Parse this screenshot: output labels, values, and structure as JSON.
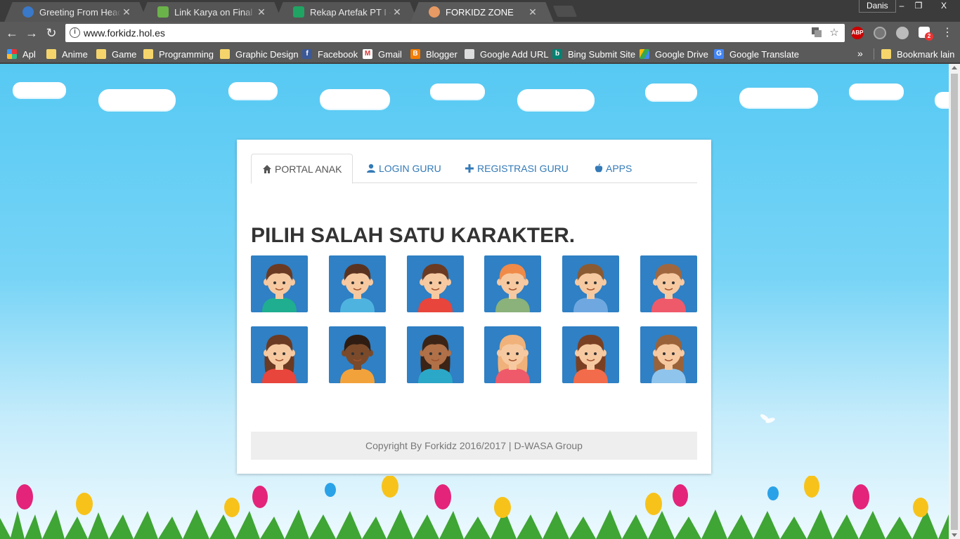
{
  "browser": {
    "tabs": [
      {
        "title": "Greeting From Head of P",
        "favicon": "globe-icon",
        "color": "#3a78c9"
      },
      {
        "title": "Link Karya on Final Yosh",
        "favicon": "trello-icon",
        "color": "#6bb24a"
      },
      {
        "title": "Rekap Artefak PT I - Goo",
        "favicon": "sheets-icon",
        "color": "#1fa463"
      },
      {
        "title": "FORKIDZ ZONE",
        "favicon": "kid-icon",
        "color": "#e79a63"
      }
    ],
    "profile_name": "Danis",
    "window_buttons": {
      "minimize": "–",
      "restore": "❐",
      "close": "X"
    },
    "url": "www.forkidz.hol.es",
    "extension_badge": "2",
    "abp_label": "ABP"
  },
  "bookmarks": {
    "items": [
      {
        "label": "Apl",
        "icon": "apps-grid-icon"
      },
      {
        "label": "Anime",
        "icon": "folder-icon"
      },
      {
        "label": "Game",
        "icon": "folder-icon"
      },
      {
        "label": "Programming",
        "icon": "folder-icon"
      },
      {
        "label": "Graphic Design",
        "icon": "folder-icon"
      },
      {
        "label": "Facebook",
        "icon": "facebook-icon"
      },
      {
        "label": "Gmail",
        "icon": "gmail-icon"
      },
      {
        "label": "Blogger",
        "icon": "blogger-icon"
      },
      {
        "label": "Google Add URL",
        "icon": "google-add-url-icon"
      },
      {
        "label": "Bing Submit Site",
        "icon": "bing-icon"
      },
      {
        "label": "Google Drive",
        "icon": "drive-icon"
      },
      {
        "label": "Google Translate",
        "icon": "translate-icon"
      }
    ],
    "more": "»",
    "other_bookmarks": "Bookmark lain"
  },
  "page": {
    "tabs": [
      {
        "label": "PORTAL ANAK",
        "icon": "home-icon",
        "active": true
      },
      {
        "label": "LOGIN GURU",
        "icon": "user-icon",
        "active": false
      },
      {
        "label": "REGISTRASI GURU",
        "icon": "plus-icon",
        "active": false
      },
      {
        "label": "APPS",
        "icon": "apple-icon",
        "active": false
      }
    ],
    "heading": "PILIH SALAH SATU KARAKTER.",
    "characters": [
      {
        "kind": "boy",
        "hair": "#6b3a22",
        "shirt": "#1fae8f"
      },
      {
        "kind": "boy",
        "hair": "#5a3320",
        "shirt": "#4fb3e0"
      },
      {
        "kind": "boy",
        "hair": "#6b3a22",
        "shirt": "#e8453c"
      },
      {
        "kind": "boy",
        "hair": "#f08a48",
        "shirt": "#8ab27a"
      },
      {
        "kind": "boy",
        "hair": "#8a5a33",
        "shirt": "#6fa8e0"
      },
      {
        "kind": "boy",
        "hair": "#a0673e",
        "shirt": "#ef5a6a"
      },
      {
        "kind": "girl",
        "hair": "#6b3a22",
        "shirt": "#e8453c"
      },
      {
        "kind": "boy-dark",
        "hair": "#2e1c12",
        "shirt": "#f2a23b"
      },
      {
        "kind": "girl-dark",
        "hair": "#3b2416",
        "shirt": "#2ba8c8"
      },
      {
        "kind": "girl",
        "hair": "#f0b27a",
        "shirt": "#ef5a6a"
      },
      {
        "kind": "girl",
        "hair": "#7a4024",
        "shirt": "#f26b4a"
      },
      {
        "kind": "girl",
        "hair": "#9a6238",
        "shirt": "#8fc4ec"
      }
    ],
    "footer": "Copyright By Forkidz 2016/2017 | D-WASA Group",
    "accent": "#2f80c4",
    "link_color": "#337ab7"
  }
}
